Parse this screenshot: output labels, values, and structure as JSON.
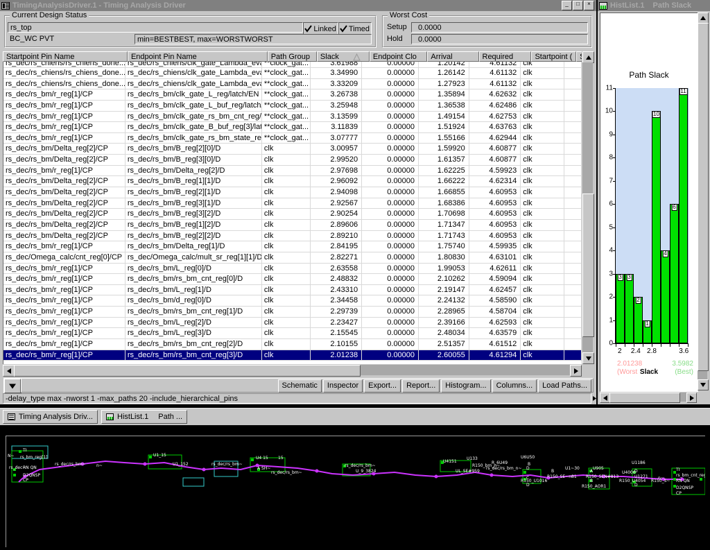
{
  "window": {
    "title": "TimingAnalysisDriver.1 - Timing Analysis Driver",
    "icon": "table-grid-icon",
    "minimize": "_",
    "maximize": "□",
    "close": "×"
  },
  "design_status": {
    "legend": "Current Design Status",
    "design_name": "rs_top",
    "linked_label": "Linked",
    "linked_checked": true,
    "timed_label": "Timed",
    "timed_checked": true,
    "pvt": "BC_WC PVT",
    "minmax": "min=BESTBEST, max=WORSTWORST"
  },
  "worst_cost": {
    "legend": "Worst Cost",
    "setup_label": "Setup",
    "setup_value": "0.0000",
    "hold_label": "Hold",
    "hold_value": "0.0000"
  },
  "table": {
    "columns": [
      "Startpoint Pin Name",
      "Endpoint Pin Name",
      "Path Group",
      "Slack",
      "Endpoint Clo",
      "Arrival",
      "Required",
      "Startpoint (",
      "Sta"
    ],
    "sort_column": "Slack",
    "sort_direction": "ascending",
    "clipped_top_row": {
      "startpoint": "rs_dec/rs_chiens/rs_chiens_done...",
      "endpoint": "rs_dec/rs_chiens/clk_gate_Lambda_eva...",
      "path_group": "**clock_gat...",
      "slack": "3.61988",
      "endpoint_clock": "0.00000",
      "arrival": "1.20142",
      "required": "4.61132",
      "startpoint_clock": "clk"
    },
    "rows": [
      {
        "startpoint": "rs_dec/rs_chiens/rs_chiens_done...",
        "endpoint": "rs_dec/rs_chiens/clk_gate_Lambda_eva...",
        "path_group": "**clock_gat...",
        "slack": "3.34990",
        "endpoint_clock": "0.00000",
        "arrival": "1.26142",
        "required": "4.61132",
        "startpoint_clock": "clk",
        "selected": false
      },
      {
        "startpoint": "rs_dec/rs_chiens/rs_chiens_done...",
        "endpoint": "rs_dec/rs_chiens/clk_gate_Lambda_eva...",
        "path_group": "**clock_gat...",
        "slack": "3.33209",
        "endpoint_clock": "0.00000",
        "arrival": "1.27923",
        "required": "4.61132",
        "startpoint_clock": "clk",
        "selected": false
      },
      {
        "startpoint": "rs_dec/rs_bm/r_reg[1]/CP",
        "endpoint": "rs_dec/rs_bm/clk_gate_L_reg/latch/EN",
        "path_group": "**clock_gat...",
        "slack": "3.26738",
        "endpoint_clock": "0.00000",
        "arrival": "1.35894",
        "required": "4.62632",
        "startpoint_clock": "clk",
        "selected": false
      },
      {
        "startpoint": "rs_dec/rs_bm/r_reg[1]/CP",
        "endpoint": "rs_dec/rs_bm/clk_gate_L_buf_reg/latch/...",
        "path_group": "**clock_gat...",
        "slack": "3.25948",
        "endpoint_clock": "0.00000",
        "arrival": "1.36538",
        "required": "4.62486",
        "startpoint_clock": "clk",
        "selected": false
      },
      {
        "startpoint": "rs_dec/rs_bm/r_reg[1]/CP",
        "endpoint": "rs_dec/rs_bm/clk_gate_rs_bm_cnt_reg/l...",
        "path_group": "**clock_gat...",
        "slack": "3.13599",
        "endpoint_clock": "0.00000",
        "arrival": "1.49154",
        "required": "4.62753",
        "startpoint_clock": "clk",
        "selected": false
      },
      {
        "startpoint": "rs_dec/rs_bm/r_reg[1]/CP",
        "endpoint": "rs_dec/rs_bm/clk_gate_B_buf_reg[3]/lat...",
        "path_group": "**clock_gat...",
        "slack": "3.11839",
        "endpoint_clock": "0.00000",
        "arrival": "1.51924",
        "required": "4.63763",
        "startpoint_clock": "clk",
        "selected": false
      },
      {
        "startpoint": "rs_dec/rs_bm/r_reg[1]/CP",
        "endpoint": "rs_dec/rs_bm/clk_gate_rs_bm_state_re...",
        "path_group": "**clock_gat...",
        "slack": "3.07777",
        "endpoint_clock": "0.00000",
        "arrival": "1.55166",
        "required": "4.62944",
        "startpoint_clock": "clk",
        "selected": false
      },
      {
        "startpoint": "rs_dec/rs_bm/Delta_reg[2]/CP",
        "endpoint": "rs_dec/rs_bm/B_reg[2][0]/D",
        "path_group": "clk",
        "slack": "3.00957",
        "endpoint_clock": "0.00000",
        "arrival": "1.59920",
        "required": "4.60877",
        "startpoint_clock": "clk",
        "selected": false
      },
      {
        "startpoint": "rs_dec/rs_bm/Delta_reg[2]/CP",
        "endpoint": "rs_dec/rs_bm/B_reg[3][0]/D",
        "path_group": "clk",
        "slack": "2.99520",
        "endpoint_clock": "0.00000",
        "arrival": "1.61357",
        "required": "4.60877",
        "startpoint_clock": "clk",
        "selected": false
      },
      {
        "startpoint": "rs_dec/rs_bm/r_reg[1]/CP",
        "endpoint": "rs_dec/rs_bm/Delta_reg[2]/D",
        "path_group": "clk",
        "slack": "2.97698",
        "endpoint_clock": "0.00000",
        "arrival": "1.62225",
        "required": "4.59923",
        "startpoint_clock": "clk",
        "selected": false
      },
      {
        "startpoint": "rs_dec/rs_bm/Delta_reg[2]/CP",
        "endpoint": "rs_dec/rs_bm/B_reg[1][1]/D",
        "path_group": "clk",
        "slack": "2.96092",
        "endpoint_clock": "0.00000",
        "arrival": "1.66222",
        "required": "4.62314",
        "startpoint_clock": "clk",
        "selected": false
      },
      {
        "startpoint": "rs_dec/rs_bm/Delta_reg[2]/CP",
        "endpoint": "rs_dec/rs_bm/B_reg[2][1]/D",
        "path_group": "clk",
        "slack": "2.94098",
        "endpoint_clock": "0.00000",
        "arrival": "1.66855",
        "required": "4.60953",
        "startpoint_clock": "clk",
        "selected": false
      },
      {
        "startpoint": "rs_dec/rs_bm/Delta_reg[2]/CP",
        "endpoint": "rs_dec/rs_bm/B_reg[3][1]/D",
        "path_group": "clk",
        "slack": "2.92567",
        "endpoint_clock": "0.00000",
        "arrival": "1.68386",
        "required": "4.60953",
        "startpoint_clock": "clk",
        "selected": false
      },
      {
        "startpoint": "rs_dec/rs_bm/Delta_reg[2]/CP",
        "endpoint": "rs_dec/rs_bm/B_reg[3][2]/D",
        "path_group": "clk",
        "slack": "2.90254",
        "endpoint_clock": "0.00000",
        "arrival": "1.70698",
        "required": "4.60953",
        "startpoint_clock": "clk",
        "selected": false
      },
      {
        "startpoint": "rs_dec/rs_bm/Delta_reg[2]/CP",
        "endpoint": "rs_dec/rs_bm/B_reg[1][2]/D",
        "path_group": "clk",
        "slack": "2.89606",
        "endpoint_clock": "0.00000",
        "arrival": "1.71347",
        "required": "4.60953",
        "startpoint_clock": "clk",
        "selected": false
      },
      {
        "startpoint": "rs_dec/rs_bm/Delta_reg[2]/CP",
        "endpoint": "rs_dec/rs_bm/B_reg[2][2]/D",
        "path_group": "clk",
        "slack": "2.89210",
        "endpoint_clock": "0.00000",
        "arrival": "1.71743",
        "required": "4.60953",
        "startpoint_clock": "clk",
        "selected": false
      },
      {
        "startpoint": "rs_dec/rs_bm/r_reg[1]/CP",
        "endpoint": "rs_dec/rs_bm/Delta_reg[1]/D",
        "path_group": "clk",
        "slack": "2.84195",
        "endpoint_clock": "0.00000",
        "arrival": "1.75740",
        "required": "4.59935",
        "startpoint_clock": "clk",
        "selected": false
      },
      {
        "startpoint": "rs_dec/Omega_calc/cnt_reg[0]/CP",
        "endpoint": "rs_dec/Omega_calc/mult_sr_reg[1][1]/D",
        "path_group": "clk",
        "slack": "2.82271",
        "endpoint_clock": "0.00000",
        "arrival": "1.80830",
        "required": "4.63101",
        "startpoint_clock": "clk",
        "selected": false
      },
      {
        "startpoint": "rs_dec/rs_bm/r_reg[1]/CP",
        "endpoint": "rs_dec/rs_bm/L_reg[0]/D",
        "path_group": "clk",
        "slack": "2.63558",
        "endpoint_clock": "0.00000",
        "arrival": "1.99053",
        "required": "4.62611",
        "startpoint_clock": "clk",
        "selected": false
      },
      {
        "startpoint": "rs_dec/rs_bm/r_reg[1]/CP",
        "endpoint": "rs_dec/rs_bm/rs_bm_cnt_reg[0]/D",
        "path_group": "clk",
        "slack": "2.48832",
        "endpoint_clock": "0.00000",
        "arrival": "2.10262",
        "required": "4.59094",
        "startpoint_clock": "clk",
        "selected": false
      },
      {
        "startpoint": "rs_dec/rs_bm/r_reg[1]/CP",
        "endpoint": "rs_dec/rs_bm/L_reg[1]/D",
        "path_group": "clk",
        "slack": "2.43310",
        "endpoint_clock": "0.00000",
        "arrival": "2.19147",
        "required": "4.62457",
        "startpoint_clock": "clk",
        "selected": false
      },
      {
        "startpoint": "rs_dec/rs_bm/r_reg[1]/CP",
        "endpoint": "rs_dec/rs_bm/d_reg[0]/D",
        "path_group": "clk",
        "slack": "2.34458",
        "endpoint_clock": "0.00000",
        "arrival": "2.24132",
        "required": "4.58590",
        "startpoint_clock": "clk",
        "selected": false
      },
      {
        "startpoint": "rs_dec/rs_bm/r_reg[1]/CP",
        "endpoint": "rs_dec/rs_bm/rs_bm_cnt_reg[1]/D",
        "path_group": "clk",
        "slack": "2.29739",
        "endpoint_clock": "0.00000",
        "arrival": "2.28965",
        "required": "4.58704",
        "startpoint_clock": "clk",
        "selected": false
      },
      {
        "startpoint": "rs_dec/rs_bm/r_reg[1]/CP",
        "endpoint": "rs_dec/rs_bm/L_reg[2]/D",
        "path_group": "clk",
        "slack": "2.23427",
        "endpoint_clock": "0.00000",
        "arrival": "2.39166",
        "required": "4.62593",
        "startpoint_clock": "clk",
        "selected": false
      },
      {
        "startpoint": "rs_dec/rs_bm/r_reg[1]/CP",
        "endpoint": "rs_dec/rs_bm/L_reg[3]/D",
        "path_group": "clk",
        "slack": "2.15545",
        "endpoint_clock": "0.00000",
        "arrival": "2.48034",
        "required": "4.63579",
        "startpoint_clock": "clk",
        "selected": false
      },
      {
        "startpoint": "rs_dec/rs_bm/r_reg[1]/CP",
        "endpoint": "rs_dec/rs_bm/rs_bm_cnt_reg[2]/D",
        "path_group": "clk",
        "slack": "2.10155",
        "endpoint_clock": "0.00000",
        "arrival": "2.51357",
        "required": "4.61512",
        "startpoint_clock": "clk",
        "selected": false
      },
      {
        "startpoint": "rs_dec/rs_bm/r_reg[1]/CP",
        "endpoint": "rs_dec/rs_bm/rs_bm_cnt_reg[3]/D",
        "path_group": "clk",
        "slack": "2.01238",
        "endpoint_clock": "0.00000",
        "arrival": "2.60055",
        "required": "4.61294",
        "startpoint_clock": "clk",
        "selected": true
      }
    ]
  },
  "buttons": {
    "schematic": "Schematic",
    "inspector": "Inspector",
    "export": "Export...",
    "report": "Report...",
    "histogram": "Histogram...",
    "columns": "Columns...",
    "load_paths": "Load Paths..."
  },
  "command_line": "-delay_type max -nworst 1 -max_paths 20 -include_hierarchical_pins",
  "histogram_window": {
    "title": "HistList.1",
    "subtitle": "Path Slack",
    "icon": "histogram-icon"
  },
  "chart_data": {
    "type": "bar",
    "title": "Path Slack",
    "xlabel": "Slack",
    "ylabel": "",
    "categories": [
      "2.0",
      "2.2",
      "2.4",
      "2.6",
      "2.8",
      "3.0",
      "3.2",
      "3.4"
    ],
    "values": [
      3,
      3,
      2,
      1,
      10,
      4,
      6,
      11
    ],
    "bar_labels": [
      "3",
      "3",
      "2",
      "1",
      "10",
      "4",
      "6",
      "11"
    ],
    "xticks": [
      "2",
      "2.4",
      "2.8",
      "3.6"
    ],
    "xtick_positions": [
      2,
      2.4,
      2.8,
      3.6
    ],
    "yticks": [
      "0",
      "1",
      "2",
      "3",
      "4",
      "5",
      "6",
      "7",
      "8",
      "9",
      "10",
      "11"
    ],
    "ylim": [
      0,
      11
    ],
    "xlim": [
      1.9,
      3.7
    ],
    "grid": false,
    "legend": "none",
    "bar_color": "#00e000",
    "plot_background": "#ccddf5",
    "worst_value": "2.01238",
    "worst_label": "(Worst",
    "worst_color": "#ff9999",
    "best_value": "3.5982",
    "best_label": "(Best)",
    "best_color": "#88dd88",
    "axis_label": "Slack"
  },
  "taskbar": {
    "items": [
      {
        "label": "Timing Analysis Driv...",
        "icon": "table-grid-icon"
      },
      {
        "label": "HistList.1",
        "label2": "Path ...",
        "icon": "histogram-icon"
      }
    ]
  },
  "schematic": {
    "name": "timing-path-schematic",
    "background": "#000000",
    "net_color": "#cc33ff",
    "cell_color": "#00cc00",
    "highlight_color": "#33cccc",
    "labels": [
      "TI",
      "rs_bm_cnt_reg[1]",
      "RN QN",
      "D2QNSP",
      "CP",
      "U1_15",
      "rs_dec/rs_bm/n~",
      "U1_152",
      "rs_dec/rs_bm~",
      "U4155",
      "U_SE#959",
      "R150_U1016",
      "R150_AOR1",
      "U1186",
      "U133",
      "R_6U49",
      "rs_dec/rs_bm_n~",
      "U6U50",
      "B",
      "R150_SE~n81",
      "R150_SEN#813",
      "U905",
      "U4006",
      "R150_U4054",
      "U1271",
      "TI",
      "rs_bm_cnt_reg[3]",
      "RN QN",
      "D2QNSP",
      "CP"
    ]
  }
}
